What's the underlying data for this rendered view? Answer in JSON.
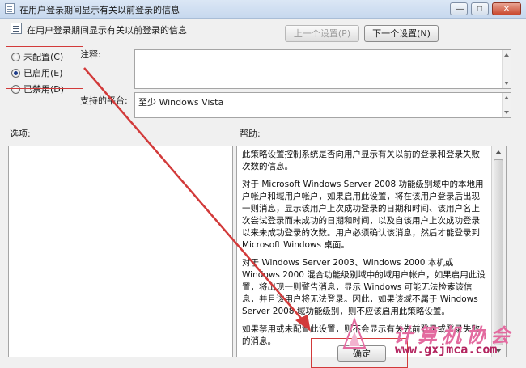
{
  "window": {
    "title": "在用户登录期间显示有关以前登录的信息",
    "minimize_glyph": "—",
    "maximize_glyph": "□",
    "close_glyph": "✕"
  },
  "header": {
    "policy_name": "在用户登录期间显示有关以前登录的信息",
    "prev_button": "上一个设置(P)",
    "next_button": "下一个设置(N)"
  },
  "state": {
    "options": [
      {
        "label": "未配置(C)",
        "checked": false
      },
      {
        "label": "已启用(E)",
        "checked": true
      },
      {
        "label": "已禁用(D)",
        "checked": false
      }
    ]
  },
  "comment": {
    "label": "注释:",
    "value": ""
  },
  "platform": {
    "label": "支持的平台:",
    "value": "至少 Windows Vista"
  },
  "options_pane": {
    "label": "选项:"
  },
  "help_pane": {
    "label": "帮助:",
    "paragraphs": [
      "此策略设置控制系统是否向用户显示有关以前的登录和登录失败次数的信息。",
      "对于 Microsoft Windows Server 2008 功能级别域中的本地用户帐户和域用户帐户，如果启用此设置，将在该用户登录后出现一则消息，显示该用户上次成功登录的日期和时间、该用户名上次尝试登录而未成功的日期和时间，以及自该用户上次成功登录以来未成功登录的次数。用户必须确认该消息，然后才能登录到 Microsoft Windows 桌面。",
      "对于 Windows Server 2003、Windows 2000 本机或 Windows 2000 混合功能级别域中的域用户帐户，如果启用此设置，将出现一则警告消息，显示 Windows 可能无法检索该信息，并且该用户将无法登录。因此，如果该域不属于 Windows Server 2008 域功能级别，则不应该启用此策略设置。",
      "如果禁用或未配置此设置，则不会显示有关先前登录或登录失败的消息。"
    ]
  },
  "footer": {
    "ok_button": "确定"
  },
  "watermark": {
    "site_name": "计算机协会",
    "url": "www.gxjmca.com"
  },
  "colors": {
    "annotation_red": "#d23a3a",
    "watermark_pink": "#e36a9f"
  }
}
